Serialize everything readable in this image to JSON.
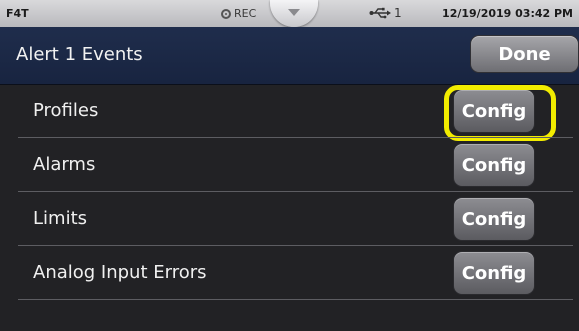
{
  "statusbar": {
    "brand": "F4T",
    "rec_label": "REC",
    "rec_icon": "record-icon",
    "pulldown_icon": "chevron-down-icon",
    "usb_icon": "usb-icon",
    "usb_count": "1",
    "datetime": "12/19/2019 03:42 PM"
  },
  "titlebar": {
    "title": "Alert 1 Events",
    "done_label": "Done"
  },
  "list": {
    "items": [
      {
        "label": "Profiles",
        "button_label": "Config",
        "highlighted": true
      },
      {
        "label": "Alarms",
        "button_label": "Config",
        "highlighted": false
      },
      {
        "label": "Limits",
        "button_label": "Config",
        "highlighted": false
      },
      {
        "label": "Analog Input Errors",
        "button_label": "Config",
        "highlighted": false
      }
    ]
  },
  "colors": {
    "title_bar": "#1f2d4c",
    "background": "#222225",
    "button": "#7a7a7f",
    "highlight": "#f2ec00"
  }
}
